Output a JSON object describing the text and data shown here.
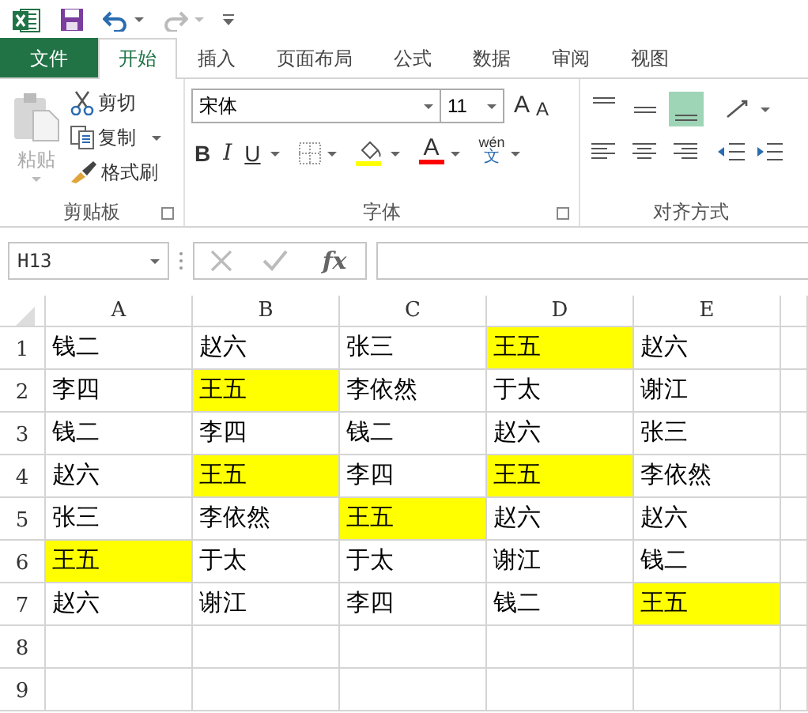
{
  "tabs": [
    {
      "label": "文件",
      "kind": "file",
      "selected": false
    },
    {
      "label": "开始",
      "kind": "tab",
      "selected": true
    },
    {
      "label": "插入",
      "kind": "tab",
      "selected": false
    },
    {
      "label": "页面布局",
      "kind": "tab",
      "selected": false
    },
    {
      "label": "公式",
      "kind": "tab",
      "selected": false
    },
    {
      "label": "数据",
      "kind": "tab",
      "selected": false
    },
    {
      "label": "审阅",
      "kind": "tab",
      "selected": false
    },
    {
      "label": "视图",
      "kind": "tab",
      "selected": false
    }
  ],
  "clipboard": {
    "paste": "粘贴",
    "cut": "剪切",
    "copy": "复制",
    "format_painter": "格式刷",
    "group_label": "剪贴板"
  },
  "font": {
    "name": "宋体",
    "size": "11",
    "grow": "A",
    "shrink": "A",
    "bold": "B",
    "italic": "I",
    "underline": "U",
    "font_color": "A",
    "phonetic_top": "wén",
    "phonetic_bottom": "文",
    "group_label": "字体"
  },
  "alignment": {
    "group_label": "对齐方式"
  },
  "formula_bar": {
    "name_box": "H13",
    "fx": "fx"
  },
  "sheet": {
    "columns": [
      "A",
      "B",
      "C",
      "D",
      "E"
    ],
    "rows": [
      {
        "number": "1",
        "cells": [
          {
            "text": "钱二",
            "highlighted": false
          },
          {
            "text": "赵六",
            "highlighted": false
          },
          {
            "text": "张三",
            "highlighted": false
          },
          {
            "text": "王五",
            "highlighted": true
          },
          {
            "text": "赵六",
            "highlighted": false
          }
        ]
      },
      {
        "number": "2",
        "cells": [
          {
            "text": "李四",
            "highlighted": false
          },
          {
            "text": "王五",
            "highlighted": true
          },
          {
            "text": "李依然",
            "highlighted": false
          },
          {
            "text": "于太",
            "highlighted": false
          },
          {
            "text": "谢江",
            "highlighted": false
          }
        ]
      },
      {
        "number": "3",
        "cells": [
          {
            "text": "钱二",
            "highlighted": false
          },
          {
            "text": "李四",
            "highlighted": false
          },
          {
            "text": "钱二",
            "highlighted": false
          },
          {
            "text": "赵六",
            "highlighted": false
          },
          {
            "text": "张三",
            "highlighted": false
          }
        ]
      },
      {
        "number": "4",
        "cells": [
          {
            "text": "赵六",
            "highlighted": false
          },
          {
            "text": "王五",
            "highlighted": true
          },
          {
            "text": "李四",
            "highlighted": false
          },
          {
            "text": "王五",
            "highlighted": true
          },
          {
            "text": "李依然",
            "highlighted": false
          }
        ]
      },
      {
        "number": "5",
        "cells": [
          {
            "text": "张三",
            "highlighted": false
          },
          {
            "text": "李依然",
            "highlighted": false
          },
          {
            "text": "王五",
            "highlighted": true
          },
          {
            "text": "赵六",
            "highlighted": false
          },
          {
            "text": "赵六",
            "highlighted": false
          }
        ]
      },
      {
        "number": "6",
        "cells": [
          {
            "text": "王五",
            "highlighted": true
          },
          {
            "text": "于太",
            "highlighted": false
          },
          {
            "text": "于太",
            "highlighted": false
          },
          {
            "text": "谢江",
            "highlighted": false
          },
          {
            "text": "钱二",
            "highlighted": false
          }
        ]
      },
      {
        "number": "7",
        "cells": [
          {
            "text": "赵六",
            "highlighted": false
          },
          {
            "text": "谢江",
            "highlighted": false
          },
          {
            "text": "李四",
            "highlighted": false
          },
          {
            "text": "钱二",
            "highlighted": false
          },
          {
            "text": "王五",
            "highlighted": true
          }
        ]
      },
      {
        "number": "8"
      },
      {
        "number": "9"
      }
    ]
  }
}
